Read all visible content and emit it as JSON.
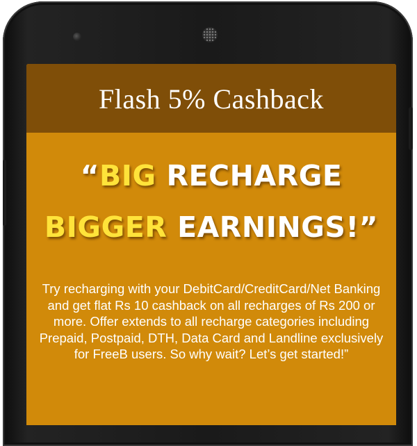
{
  "header": {
    "title": "Flash 5% Cashback"
  },
  "headline": {
    "line1": {
      "open_quote": "“",
      "highlight": "BIG",
      "rest": " RECHARGE"
    },
    "line2": {
      "highlight": "BIGGER",
      "rest": " EARNINGS!”"
    }
  },
  "body": {
    "text": "Try recharging with your DebitCard/CreditCard/Net Banking and get flat Rs 10 cashback on all recharges of Rs 200 or more. Offer extends to all recharge categories including Prepaid, Postpaid, DTH, Data Card and Landline exclusively for FreeB users. So why wait? Let’s get started!”"
  },
  "colors": {
    "header_bg": "#7f4e08",
    "screen_bg": "#d18a0a",
    "highlight": "#ffe33a",
    "text": "#ffffff"
  },
  "icons": {
    "sensor": "front-sensor-icon",
    "speaker": "earpiece-speaker-icon"
  }
}
